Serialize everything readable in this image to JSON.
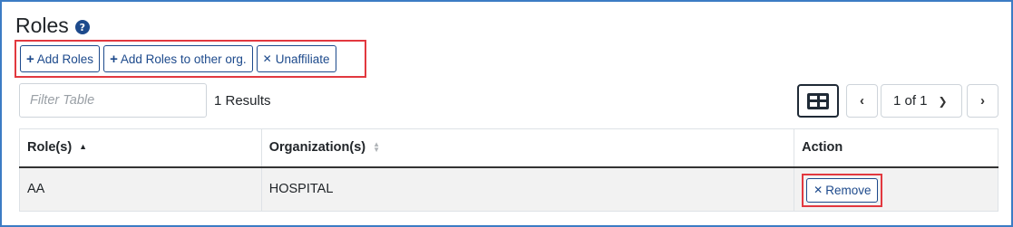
{
  "page": {
    "title": "Roles",
    "help_icon": "question-circle-icon"
  },
  "toolbar": {
    "add_roles_label": "Add Roles",
    "add_roles_other_label": "Add Roles to other org.",
    "unaffiliate_label": "Unaffiliate",
    "plus_icon": "+",
    "x_icon": "✕"
  },
  "filter": {
    "placeholder": "Filter Table",
    "results_text": "1 Results"
  },
  "pagination": {
    "prev_icon": "‹",
    "next_icon": "›",
    "current": "1 of 1",
    "chevron": "⌄"
  },
  "table": {
    "headers": {
      "roles": "Role(s)",
      "organizations": "Organization(s)",
      "action": "Action"
    },
    "rows": [
      {
        "role": "AA",
        "organization": "HOSPITAL",
        "action_label": "Remove"
      }
    ]
  },
  "colors": {
    "accent": "#1d4a8c",
    "highlight": "#e2383f",
    "frame": "#3c7cc4"
  }
}
